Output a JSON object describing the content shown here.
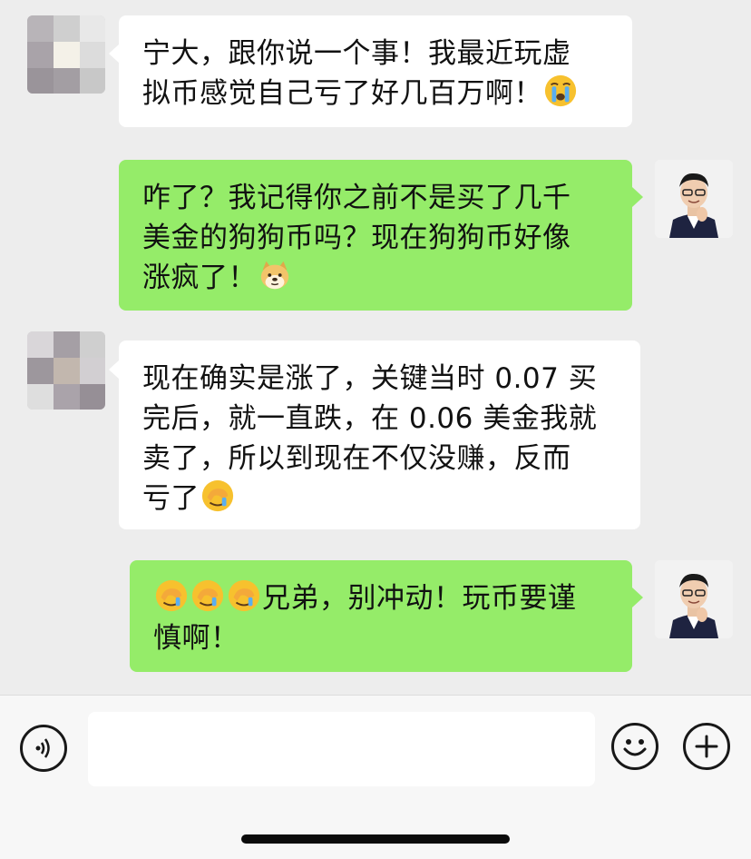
{
  "chat": {
    "messages": [
      {
        "side": "left",
        "sender": "other",
        "text": "宁大，跟你说一个事！我最近玩虚拟币感觉自己亏了好几百万啊！",
        "emoji_after": [
          "crying-face"
        ]
      },
      {
        "side": "right",
        "sender": "self",
        "text": "咋了？我记得你之前不是买了几千美金的狗狗币吗？现在狗狗币好像涨疯了！",
        "emoji_after": [
          "doge"
        ]
      },
      {
        "side": "left",
        "sender": "other",
        "text": "现在确实是涨了，关键当时 0.07 买完后，就一直跌，在 0.06 美金我就卖了，所以到现在不仅没赚，反而亏了",
        "emoji_after": [
          "facepalm"
        ]
      },
      {
        "side": "right",
        "sender": "self",
        "emoji_before": [
          "facepalm",
          "facepalm",
          "facepalm"
        ],
        "text": "兄弟，别冲动！玩币要谨慎啊！"
      }
    ],
    "line_breaks": {
      "m0": [
        "宁大，跟你说一个事！我最近玩虚",
        "拟币感觉自己亏了好几百万啊！"
      ],
      "m1": [
        "咋了？我记得你之前不是买了几千",
        "美金的狗狗币吗？现在狗狗币好像",
        "涨疯了！"
      ],
      "m2": [
        "现在确实是涨了，关键当时 0.07 买",
        "完后，就一直跌，在 0.06 美金我就",
        "卖了，所以到现在不仅没赚，反而",
        "亏了"
      ],
      "m3": [
        "兄弟，别冲动！玩币要谨",
        "慎啊！"
      ]
    }
  },
  "input_bar": {
    "voice_icon": "voice-icon",
    "emoji_icon": "smiley-icon",
    "plus_icon": "plus-icon",
    "text_value": ""
  },
  "colors": {
    "background": "#ededed",
    "bubble_self": "#95ec69",
    "bubble_other": "#ffffff",
    "input_bar": "#f7f7f7"
  }
}
